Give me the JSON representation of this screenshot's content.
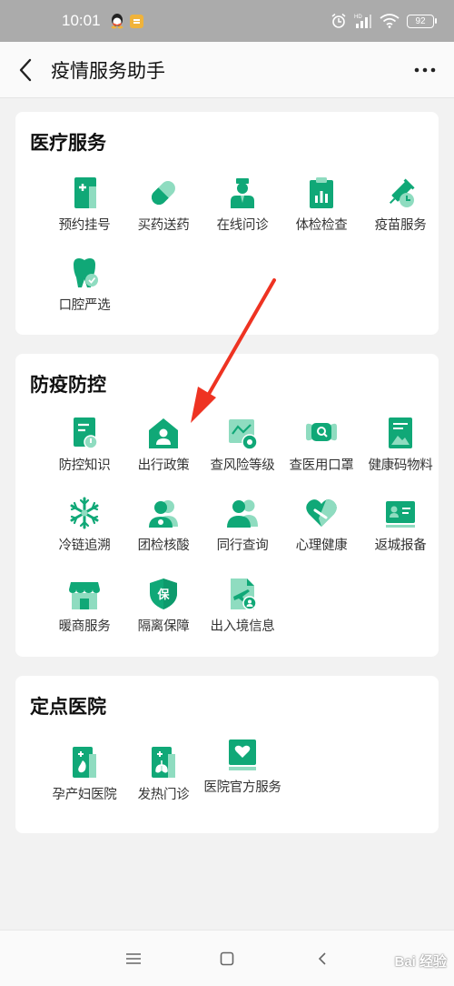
{
  "status_bar": {
    "time": "10:01",
    "battery": "92"
  },
  "nav": {
    "title": "疫情服务助手"
  },
  "colors": {
    "accent": "#10a877",
    "accent_light": "#8fdcc0",
    "arrow": "#ee3322"
  },
  "sections": [
    {
      "title": "医疗服务",
      "items": [
        {
          "label": "预约挂号",
          "icon": "registration-icon"
        },
        {
          "label": "买药送药",
          "icon": "pill-icon"
        },
        {
          "label": "在线问诊",
          "icon": "doctor-icon"
        },
        {
          "label": "体检检查",
          "icon": "clipboard-icon"
        },
        {
          "label": "疫苗服务",
          "icon": "vaccine-icon"
        },
        {
          "label": "口腔严选",
          "icon": "tooth-icon"
        }
      ]
    },
    {
      "title": "防疫防控",
      "items": [
        {
          "label": "防控知识",
          "icon": "document-icon"
        },
        {
          "label": "出行政策",
          "icon": "house-person-icon"
        },
        {
          "label": "查风险等级",
          "icon": "risk-chart-icon"
        },
        {
          "label": "查医用口罩",
          "icon": "mask-icon"
        },
        {
          "label": "健康码物料",
          "icon": "health-code-icon"
        },
        {
          "label": "冷链追溯",
          "icon": "snowflake-icon"
        },
        {
          "label": "团检核酸",
          "icon": "group-test-icon"
        },
        {
          "label": "同行查询",
          "icon": "companion-icon"
        },
        {
          "label": "心理健康",
          "icon": "heart-icon"
        },
        {
          "label": "返城报备",
          "icon": "id-card-icon"
        },
        {
          "label": "暖商服务",
          "icon": "shop-icon"
        },
        {
          "label": "隔离保障",
          "icon": "shield-icon"
        },
        {
          "label": "出入境信息",
          "icon": "plane-doc-icon"
        }
      ]
    },
    {
      "title": "定点医院",
      "items": [
        {
          "label": "孕产妇医院",
          "icon": "maternity-icon"
        },
        {
          "label": "发热门诊",
          "icon": "fever-clinic-icon"
        },
        {
          "label": "医院官方服务",
          "icon": "hospital-heart-icon"
        }
      ]
    }
  ],
  "watermark": "Bai 经验"
}
